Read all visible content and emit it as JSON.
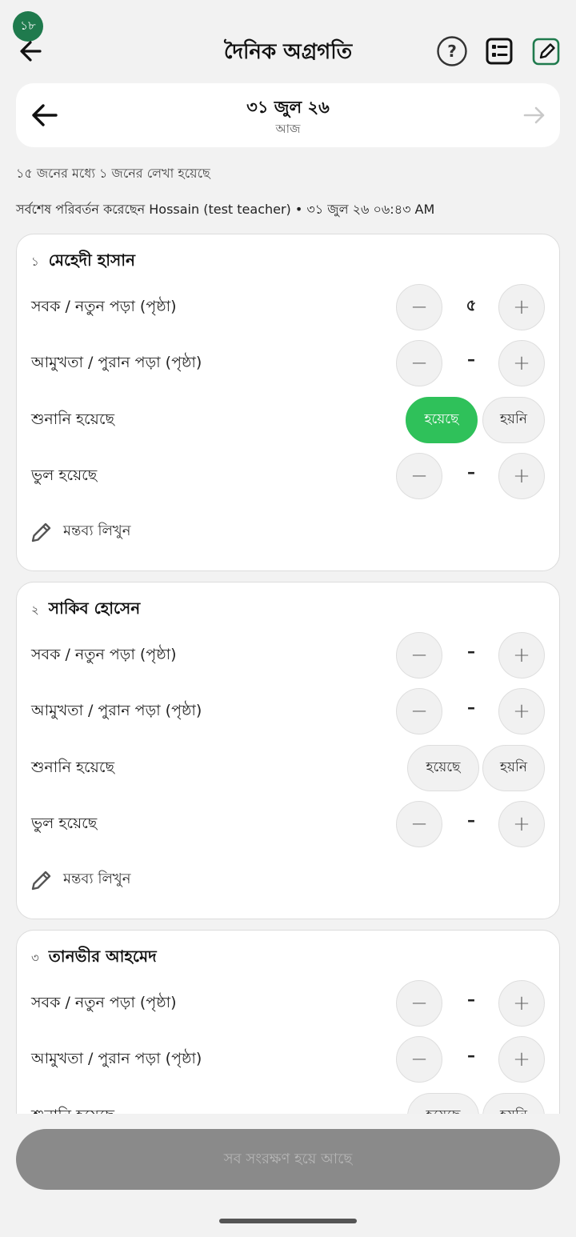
{
  "status": {
    "badge": "১৮"
  },
  "header": {
    "title": "দৈনিক অগ্রগতি"
  },
  "date_nav": {
    "date": "৩১ জুল ২৬",
    "relative": "আজ"
  },
  "summary": {
    "count_text": "১৫ জনের মধ্যে ১ জনের লেখা হয়েছে",
    "modified_text": "সর্বশেষ পরিবর্তন করেছেন Hossain (test teacher) • ৩১ জুল ২৬ ০৬:৪৩ AM"
  },
  "labels": {
    "lesson": "সবক / নতুন পড়া (পৃষ্ঠা)",
    "revision": "আমুখতা / পুরান পড়া (পৃষ্ঠা)",
    "recited": "শুনানি হয়েছে",
    "mistakes": "ভুল হয়েছে",
    "done": "হয়েছে",
    "not_done": "হয়নি",
    "comment": "মন্তব্য লিখুন",
    "minus": "−",
    "plus": "+"
  },
  "students": [
    {
      "num": "১",
      "name": "মেহেদী হাসান",
      "lesson": "৫",
      "revision": "–",
      "recited": "done",
      "mistakes": "–"
    },
    {
      "num": "২",
      "name": "সাকিব হোসেন",
      "lesson": "–",
      "revision": "–",
      "recited": "none",
      "mistakes": "–"
    },
    {
      "num": "৩",
      "name": "তানভীর আহমেদ",
      "lesson": "–",
      "revision": "–",
      "recited": "none",
      "mistakes": "–"
    }
  ],
  "footer": {
    "save_label": "সব সংরক্ষণ হয়ে আছে"
  },
  "colors": {
    "accent_green": "#2fc15a",
    "badge_green": "#1f7a4d"
  }
}
